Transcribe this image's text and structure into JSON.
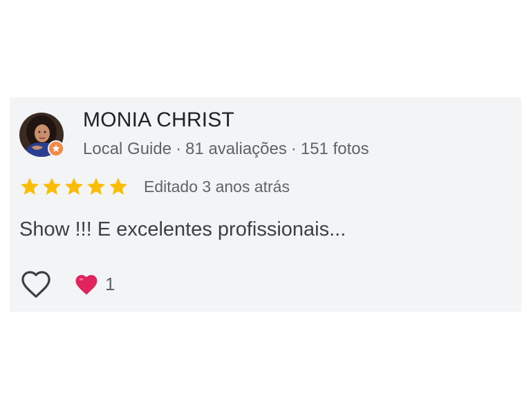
{
  "review": {
    "author_name": "MONIA CHRIST",
    "author_meta": {
      "role": "Local Guide",
      "separator": "·",
      "reviews_count": "81 avaliações",
      "photos_count": "151 fotos"
    },
    "rating": 5,
    "max_rating": 5,
    "edited_text": "Editado 3 anos atrás",
    "text": "Show !!! E excelentes profissionais...",
    "reactions": {
      "like_icon": "heart-outline-icon",
      "reaction_icon": "red-heart-icon",
      "reaction_count": "1"
    }
  },
  "colors": {
    "card_background": "#f3f4f6",
    "star": "#fbbc04",
    "badge": "#f0894a",
    "reaction_heart": "#e0245e"
  }
}
